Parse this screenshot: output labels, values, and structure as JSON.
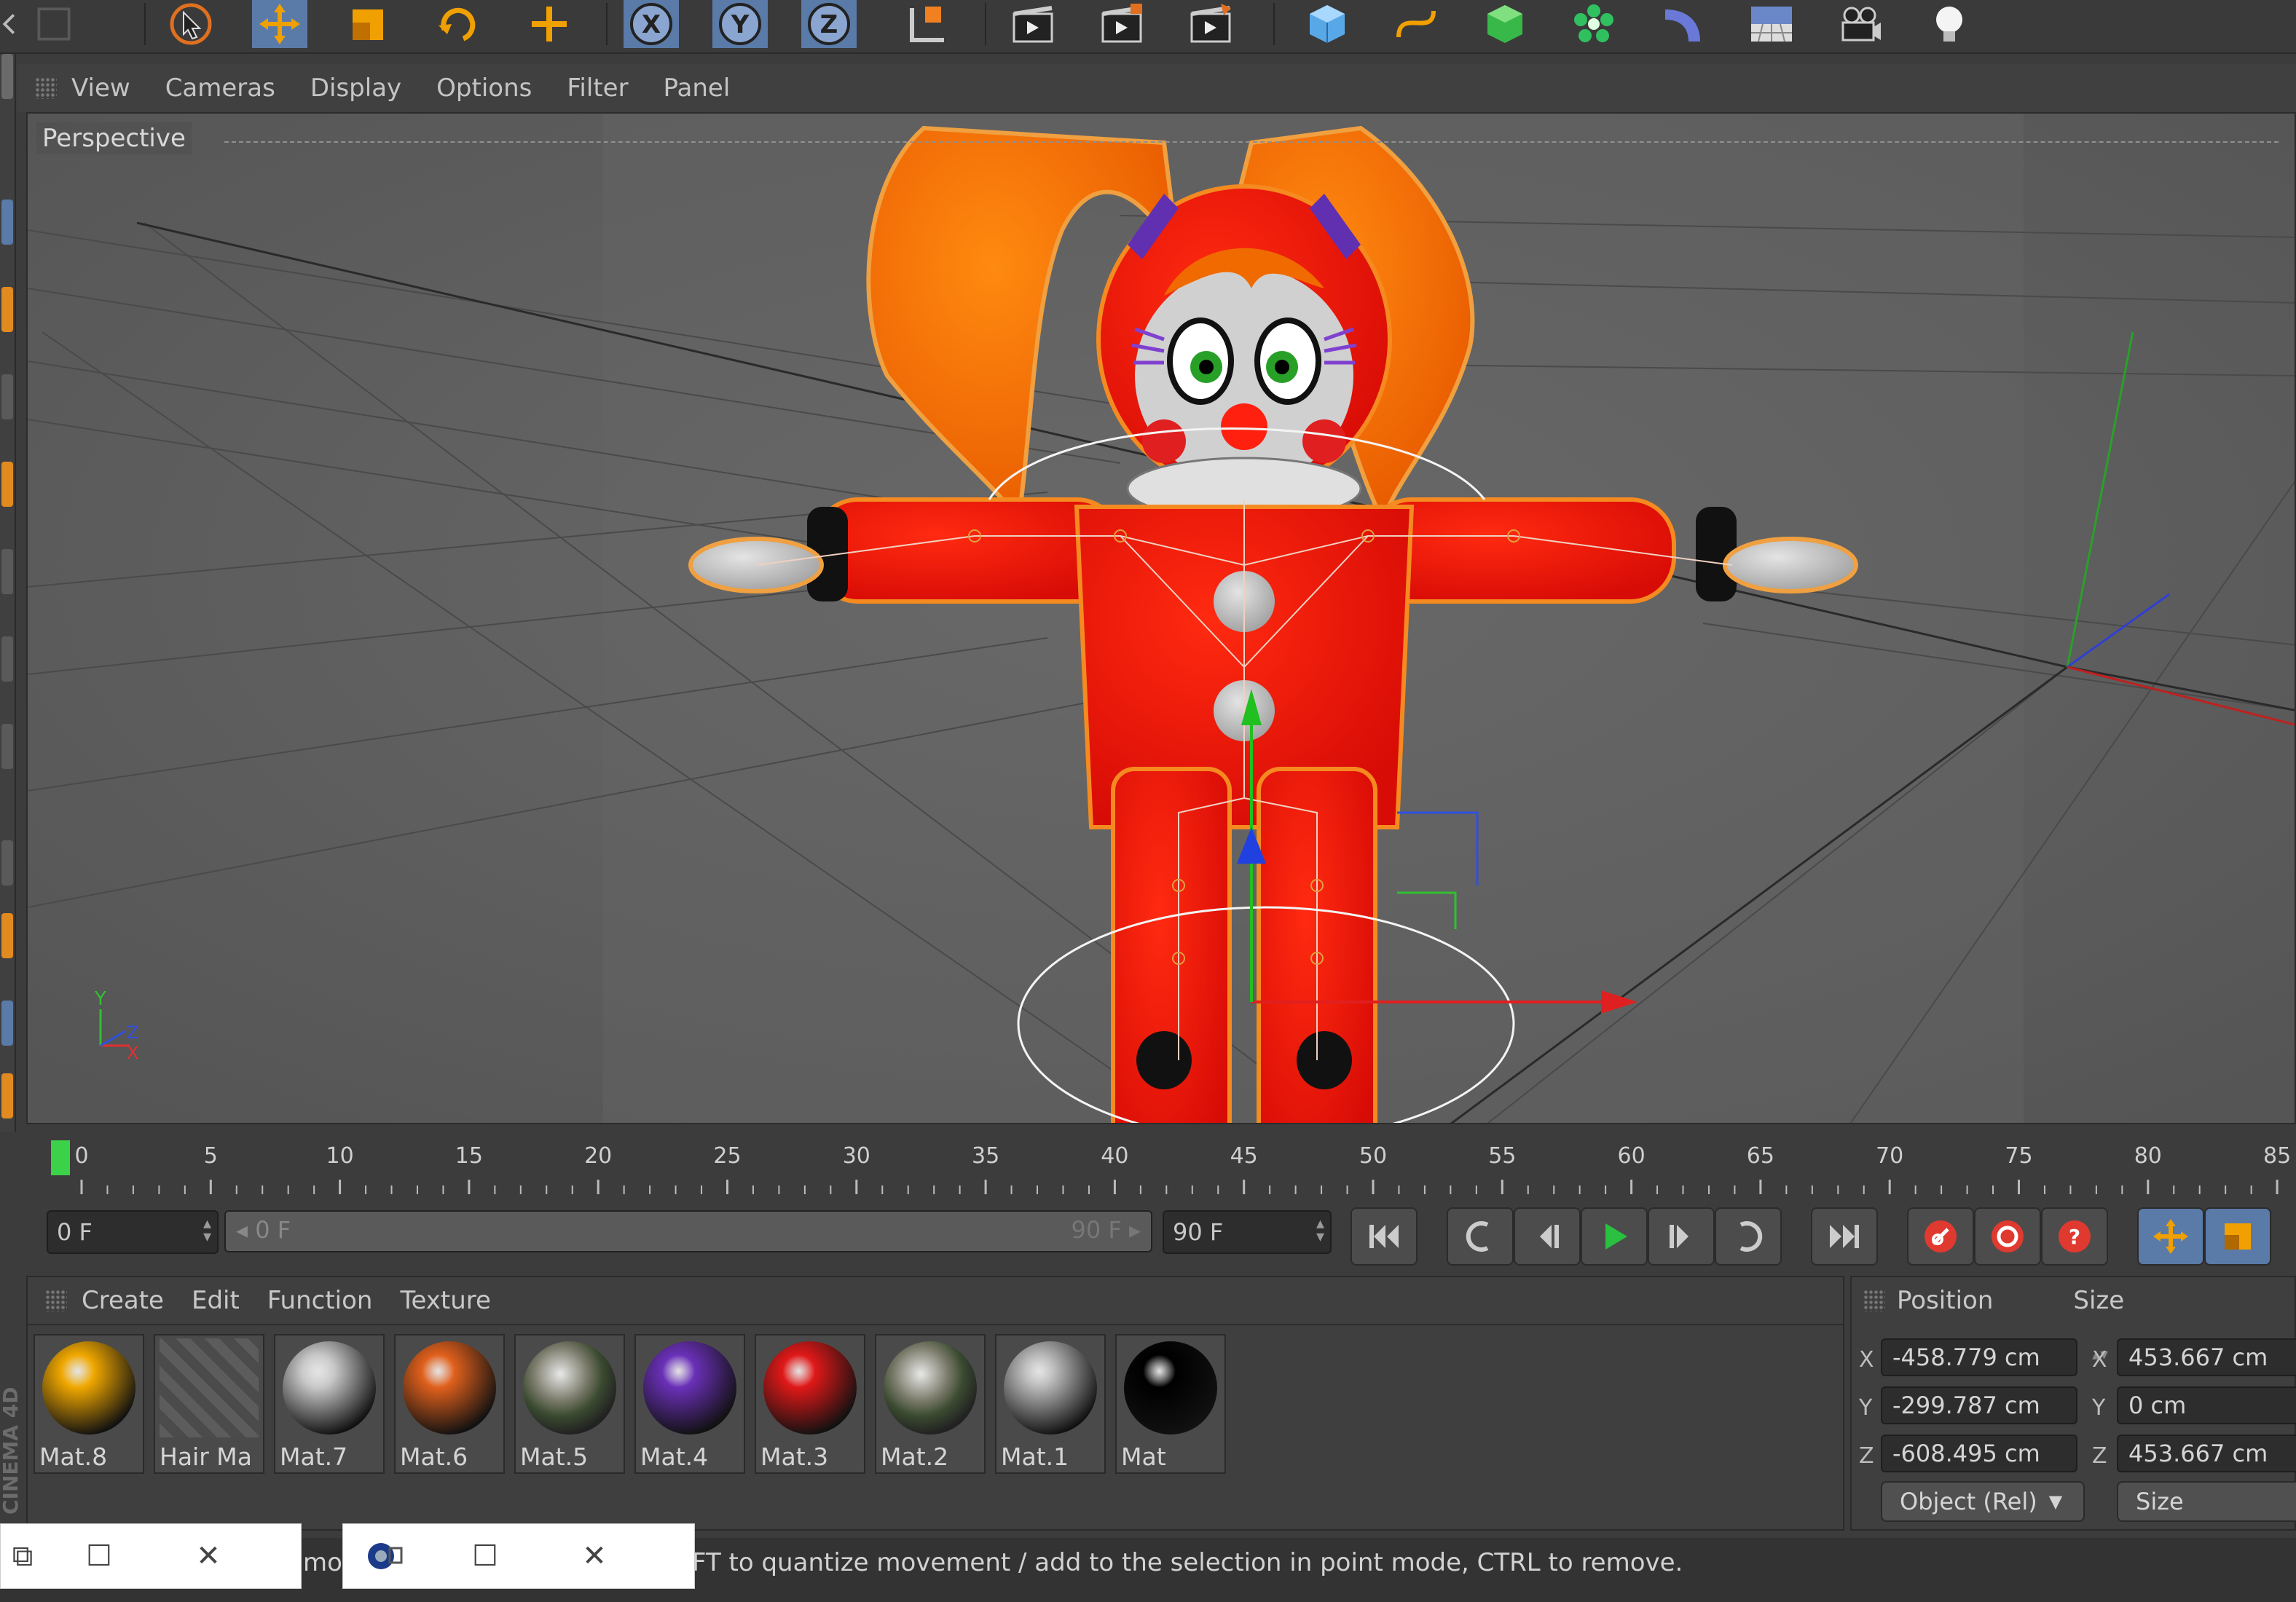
{
  "toolbar": {
    "icons": [
      "undo-icon",
      "redo-icon",
      "select-cursor-icon",
      "move-icon",
      "scale-icon",
      "rotate-icon",
      "add-object-icon",
      "x-axis-lock-icon",
      "y-axis-lock-icon",
      "z-axis-lock-icon",
      "coordinate-system-icon",
      "render-view-icon",
      "render-picture-viewer-icon",
      "render-settings-icon",
      "cube-primitive-icon",
      "spline-icon",
      "nurbs-icon",
      "array-icon",
      "deformer-icon",
      "floor-icon",
      "camera-icon",
      "light-icon"
    ],
    "axis_labels": [
      "X",
      "Y",
      "Z"
    ]
  },
  "viewport": {
    "menu": [
      "View",
      "Cameras",
      "Display",
      "Options",
      "Filter",
      "Panel"
    ],
    "camera_label": "Perspective",
    "axis_y": "Y",
    "axis_x": "X",
    "axis_z": "Z"
  },
  "timeline": {
    "ticks": [
      "0",
      "5",
      "10",
      "15",
      "20",
      "25",
      "30",
      "35",
      "40",
      "45",
      "50",
      "55",
      "60",
      "65",
      "70",
      "75",
      "80",
      "85"
    ],
    "current_frame": "0 F",
    "range_start": "0 F",
    "range_end": "90 F",
    "end_frame": "90 F"
  },
  "materials": {
    "menu": [
      "Create",
      "Edit",
      "Function",
      "Texture"
    ],
    "items": [
      {
        "name": "Mat.8",
        "color": "#f0a800"
      },
      {
        "name": "Hair Ma",
        "color": "hatch"
      },
      {
        "name": "Mat.7",
        "color": "#c8c8c8"
      },
      {
        "name": "Mat.6",
        "color": "#e0601c"
      },
      {
        "name": "Mat.5",
        "color": "chrome"
      },
      {
        "name": "Mat.4",
        "color": "#6a30b8"
      },
      {
        "name": "Mat.3",
        "color": "#e01818"
      },
      {
        "name": "Mat.2",
        "color": "chrome"
      },
      {
        "name": "Mat.1",
        "color": "#b8b8b8"
      },
      {
        "name": "Mat",
        "color": "#000000"
      }
    ]
  },
  "attributes": {
    "position_label": "Position",
    "size_label": "Size",
    "axes": [
      "X",
      "Y",
      "Z"
    ],
    "position": [
      "-458.779 cm",
      "-299.787 cm",
      "-608.495 cm"
    ],
    "size": [
      "453.667 cm",
      "0 cm",
      "453.667 cm"
    ],
    "mode_dropdown": "Object (Rel)",
    "size_dropdown": "Size"
  },
  "status": {
    "text": "FT to quantize movement / add to the selection in point mode, CTRL to remove.",
    "fragment": "mo"
  },
  "side_brand": "CINEMA 4D",
  "colors": {
    "accent_blue": "#5a7aa8",
    "orange": "#f0a000",
    "character_red": "#f01c0c",
    "hair_orange": "#f56b00"
  }
}
